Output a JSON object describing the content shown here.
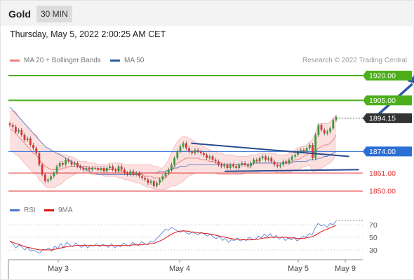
{
  "header": {
    "instrument": "Gold",
    "timeframe": "30 MIN",
    "datetime": "Thursday, May 5, 2022 2:00:25 AM CET"
  },
  "legend": {
    "ma20_label": "MA 20 + Bollinger Bands",
    "ma50_label": "MA 50",
    "ma20_color": "#f08080",
    "ma50_color": "#2c5aa0",
    "credit": "Research © 2022 Trading Central"
  },
  "rsi_legend": {
    "rsi_label": "RSI",
    "ma9_label": "9MA",
    "rsi_color": "#4a78d0",
    "ma9_color": "#e01010"
  },
  "chart_data": {
    "type": "candlestick",
    "x_ticks": [
      "May 3",
      "May 4",
      "May 5",
      "May 9"
    ],
    "price_levels": [
      {
        "label": "1920.00",
        "value": 1920.0,
        "kind": "target",
        "color": "#4caf1a"
      },
      {
        "label": "1905.00",
        "value": 1905.0,
        "kind": "resistance",
        "color": "#4caf1a"
      },
      {
        "label": "1894.15",
        "value": 1894.15,
        "kind": "last-price",
        "color": "#333333"
      },
      {
        "label": "1874.00",
        "value": 1874.0,
        "kind": "pivot",
        "color": "#2c6fd6"
      },
      {
        "label": "1861.00",
        "value": 1861.0,
        "kind": "support",
        "color": "#e03030"
      },
      {
        "label": "1850.00",
        "value": 1850.0,
        "kind": "support",
        "color": "#e03030"
      }
    ],
    "ylim": [
      1845,
      1925
    ],
    "closes": [
      1890,
      1889,
      1886,
      1887,
      1884,
      1881,
      1882,
      1878,
      1876,
      1873,
      1866,
      1860,
      1856,
      1857,
      1859,
      1861,
      1865,
      1867,
      1866,
      1869,
      1868,
      1866,
      1867,
      1865,
      1864,
      1863,
      1864,
      1863,
      1864,
      1864,
      1863,
      1864,
      1862,
      1864,
      1865,
      1863,
      1862,
      1865,
      1863,
      1861,
      1860,
      1862,
      1860,
      1861,
      1859,
      1858,
      1857,
      1855,
      1856,
      1853,
      1855,
      1857,
      1859,
      1861,
      1863,
      1866,
      1870,
      1874,
      1877,
      1879,
      1876,
      1874,
      1873,
      1875,
      1874,
      1873,
      1872,
      1870,
      1871,
      1869,
      1868,
      1866,
      1865,
      1866,
      1864,
      1866,
      1865,
      1864,
      1866,
      1867,
      1866,
      1865,
      1867,
      1869,
      1868,
      1870,
      1871,
      1869,
      1870,
      1868,
      1866,
      1865,
      1866,
      1868,
      1867,
      1869,
      1871,
      1872,
      1874,
      1875,
      1874,
      1876,
      1878,
      1870,
      1884,
      1890,
      1887,
      1885,
      1886,
      1888,
      1893,
      1895
    ],
    "ma20_band_upper": [
      1898,
      1899,
      1898,
      1895,
      1893,
      1891,
      1889,
      1887,
      1885,
      1884,
      1881,
      1879,
      1877,
      1876,
      1875,
      1874,
      1873,
      1873,
      1872,
      1872,
      1871,
      1871,
      1870,
      1869,
      1868,
      1868,
      1868,
      1867,
      1867,
      1867,
      1866,
      1866,
      1866,
      1866,
      1867,
      1867,
      1867,
      1867,
      1867,
      1866,
      1866,
      1866,
      1866,
      1866,
      1866,
      1866,
      1866,
      1866,
      1866,
      1865,
      1865,
      1864,
      1864,
      1866,
      1869,
      1873,
      1877,
      1880,
      1882,
      1883,
      1883,
      1882,
      1881,
      1880,
      1879,
      1878,
      1877,
      1876,
      1875,
      1874,
      1874,
      1873,
      1873,
      1872,
      1872,
      1872,
      1872,
      1871,
      1871,
      1871,
      1871,
      1871,
      1872,
      1872,
      1872,
      1873,
      1873,
      1873,
      1873,
      1873,
      1873,
      1872,
      1872,
      1872,
      1872,
      1873,
      1874,
      1875,
      1876,
      1877,
      1877,
      1878,
      1880,
      1881,
      1886,
      1890,
      1891,
      1891,
      1891,
      1892,
      1894,
      1896
    ],
    "ma20_band_lower": [
      1876,
      1874,
      1872,
      1871,
      1869,
      1867,
      1865,
      1863,
      1861,
      1860,
      1857,
      1855,
      1853,
      1852,
      1852,
      1852,
      1853,
      1854,
      1855,
      1857,
      1858,
      1859,
      1860,
      1861,
      1861,
      1861,
      1861,
      1861,
      1860,
      1860,
      1860,
      1860,
      1859,
      1859,
      1859,
      1859,
      1859,
      1858,
      1858,
      1857,
      1857,
      1856,
      1856,
      1855,
      1855,
      1854,
      1853,
      1852,
      1852,
      1851,
      1851,
      1851,
      1851,
      1851,
      1852,
      1853,
      1853,
      1854,
      1855,
      1856,
      1858,
      1859,
      1860,
      1861,
      1861,
      1861,
      1861,
      1861,
      1861,
      1861,
      1861,
      1860,
      1860,
      1860,
      1860,
      1860,
      1860,
      1860,
      1860,
      1860,
      1861,
      1861,
      1861,
      1861,
      1861,
      1862,
      1862,
      1862,
      1862,
      1862,
      1862,
      1861,
      1861,
      1861,
      1861,
      1861,
      1862,
      1863,
      1863,
      1864,
      1865,
      1865,
      1866,
      1862,
      1862,
      1863,
      1864,
      1865,
      1866,
      1867,
      1869,
      1872
    ],
    "ma20": [
      1887,
      1887,
      1885,
      1883,
      1881,
      1879,
      1877,
      1875,
      1873,
      1872,
      1869,
      1867,
      1865,
      1864,
      1863,
      1863,
      1863,
      1863,
      1864,
      1864,
      1865,
      1865,
      1865,
      1865,
      1865,
      1865,
      1865,
      1864,
      1864,
      1864,
      1863,
      1863,
      1863,
      1863,
      1863,
      1863,
      1863,
      1863,
      1862,
      1862,
      1861,
      1861,
      1861,
      1861,
      1860,
      1860,
      1859,
      1859,
      1859,
      1858,
      1858,
      1858,
      1858,
      1858,
      1860,
      1862,
      1865,
      1867,
      1868,
      1869,
      1870,
      1870,
      1870,
      1870,
      1870,
      1869,
      1869,
      1869,
      1868,
      1868,
      1867,
      1867,
      1867,
      1866,
      1866,
      1866,
      1866,
      1866,
      1866,
      1866,
      1866,
      1866,
      1866,
      1867,
      1867,
      1867,
      1867,
      1867,
      1867,
      1867,
      1867,
      1867,
      1867,
      1867,
      1867,
      1867,
      1868,
      1869,
      1869,
      1870,
      1871,
      1872,
      1873,
      1873,
      1874,
      1876,
      1877,
      1878,
      1878,
      1879,
      1881,
      1884
    ],
    "ma50": [
      1901,
      1899,
      1897,
      1895,
      1893,
      1891,
      1889,
      1887,
      1885,
      1883,
      1881,
      1879,
      1877,
      1876,
      1875,
      1874,
      1873,
      1872,
      1871,
      1870,
      1869,
      1868,
      1867,
      1866,
      1865,
      1864,
      1863,
      1862,
      1861,
      1861,
      1860,
      1860,
      1860,
      1860,
      1860,
      1860,
      1860,
      1860,
      1860,
      1860,
      1860,
      1860,
      1860,
      1860,
      1860,
      1861,
      1861,
      1861,
      1861,
      1861,
      1861,
      1862,
      1862,
      1862,
      1863,
      1863,
      1864,
      1864,
      1865,
      1865,
      1865,
      1866,
      1866,
      1866,
      1866,
      1866,
      1866,
      1866,
      1866,
      1866,
      1866,
      1866,
      1866,
      1866,
      1866,
      1866,
      1866,
      1866,
      1866,
      1866,
      1866,
      1866,
      1866,
      1867,
      1867,
      1867,
      1867,
      1867,
      1867,
      1867,
      1867,
      1867,
      1867,
      1867,
      1867,
      1867,
      1867,
      1868,
      1868,
      1868,
      1868,
      1868,
      1869,
      1869,
      1869,
      1870,
      1870,
      1871,
      1871,
      1872,
      1873,
      1874
    ],
    "triangle": {
      "upper": [
        [
          1879,
          56
        ],
        [
          1871,
          104
        ]
      ],
      "lower": [
        [
          1862,
          68
        ],
        [
          1863,
          107
        ]
      ]
    },
    "projection_arrow": {
      "from": [
        1894,
        112
      ],
      "to": [
        1920,
        124
      ]
    },
    "rsi": {
      "ticks": [
        "70",
        "50",
        "30"
      ],
      "rsi_values": [
        44,
        40,
        33,
        38,
        35,
        30,
        34,
        28,
        30,
        27,
        25,
        31,
        30,
        33,
        28,
        36,
        32,
        40,
        34,
        42,
        38,
        35,
        41,
        37,
        34,
        39,
        33,
        38,
        36,
        40,
        35,
        39,
        37,
        34,
        40,
        33,
        37,
        35,
        41,
        38,
        36,
        42,
        39,
        37,
        43,
        40,
        38,
        44,
        42,
        48,
        52,
        58,
        63,
        61,
        66,
        63,
        60,
        58,
        61,
        57,
        55,
        59,
        56,
        54,
        58,
        55,
        52,
        55,
        50,
        48,
        52,
        45,
        48,
        42,
        46,
        45,
        49,
        44,
        47,
        45,
        50,
        47,
        46,
        52,
        49,
        55,
        51,
        56,
        49,
        53,
        47,
        51,
        45,
        49,
        46,
        50,
        44,
        48,
        52,
        50,
        56,
        54,
        65,
        72,
        68,
        70,
        66,
        72,
        70,
        76
      ],
      "ma9_values": [
        44,
        42,
        40,
        39,
        37,
        35,
        34,
        33,
        32,
        31,
        30,
        30,
        30,
        30,
        30,
        31,
        32,
        33,
        34,
        35,
        36,
        36,
        37,
        37,
        37,
        37,
        37,
        37,
        37,
        37,
        37,
        37,
        37,
        37,
        37,
        37,
        37,
        37,
        37,
        37,
        37,
        38,
        38,
        38,
        38,
        39,
        39,
        40,
        40,
        42,
        44,
        46,
        49,
        52,
        55,
        57,
        59,
        60,
        60,
        60,
        59,
        58,
        58,
        57,
        57,
        56,
        56,
        55,
        54,
        53,
        52,
        51,
        50,
        49,
        48,
        47,
        47,
        47,
        46,
        46,
        46,
        46,
        47,
        47,
        48,
        49,
        49,
        50,
        50,
        50,
        50,
        50,
        50,
        49,
        49,
        49,
        48,
        48,
        48,
        49,
        50,
        51,
        53,
        56,
        59,
        61,
        63,
        65,
        67,
        69
      ]
    }
  }
}
